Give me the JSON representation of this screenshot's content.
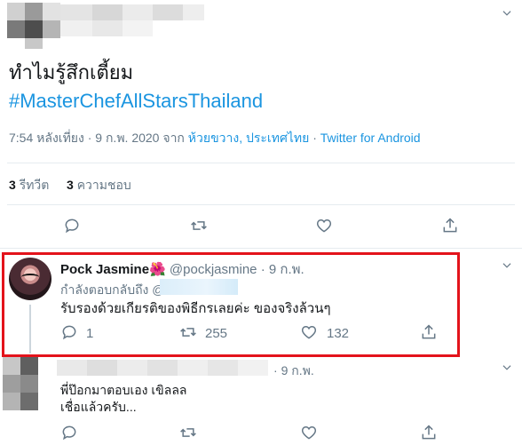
{
  "tweet": {
    "text_line1": "ทำไมรู้สึกเตี้ยม",
    "hashtag": "#MasterChefAllStarsThailand",
    "time_date": "7:54 หลังเที่ยง · 9 ก.พ. 2020 จาก",
    "location": "ห้วยขวาง, ประเทศไทย",
    "separator": "·",
    "client": "Twitter for Android",
    "retweets_count": "3",
    "retweets_label": "รีทวีต",
    "likes_count": "3",
    "likes_label": "ความชอบ"
  },
  "reply1": {
    "name": "Pock Jasmine",
    "emoji": "🌺",
    "handle": "@pockjasmine",
    "dot": "·",
    "date": "9 ก.พ.",
    "replying_to": "กำลังตอบกลับถึง @",
    "text": "รับรองด้วยเกียรติของพิธีกรเลยค่ะ ของจริงล้วนๆ",
    "replies": "1",
    "retweets": "255",
    "likes": "132"
  },
  "reply2": {
    "dot": "·",
    "date": "9 ก.พ.",
    "text_line1": "พี่ป๊อกมาตอบเอง เขิลลล",
    "text_line2": "เชื่อแล้วครับ..."
  },
  "icons": {
    "reply": "reply-icon",
    "retweet": "retweet-icon",
    "like": "heart-icon",
    "share": "share-icon",
    "more": "chevron-down-icon"
  },
  "colors": {
    "link": "#1b95e0",
    "muted": "#657786",
    "highlight": "#e3131b"
  }
}
